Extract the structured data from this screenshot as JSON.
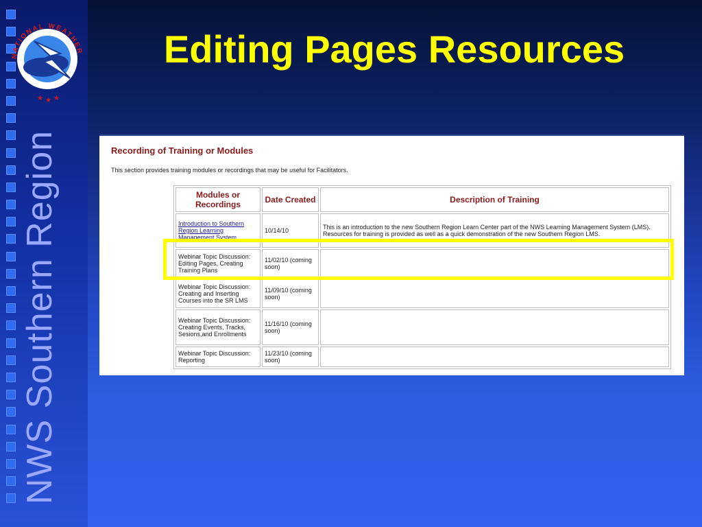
{
  "slide": {
    "title": "Editing Pages Resources",
    "sidebar_text": "NWS Southern Region",
    "logo": {
      "arc_text": "NATIONAL WEATHER SERVICE",
      "icon": "nws-logo-icon"
    }
  },
  "screenshot": {
    "heading": "Recording of Training or Modules",
    "intro": "This section provides training modules or recordings that may be useful for Facilitators.",
    "columns": [
      "Modules or Recordings",
      "Date Created",
      "Description of Training"
    ],
    "rows": [
      {
        "module": "Introduction to Southern Region Learning Management System",
        "date": "10/14/10",
        "description": "This is an introduction to the new Southern Region Learn Center part of the NWS Learning Management System (LMS). Resources for training is provided as well as a quick demonstration of the new Southern Region LMS."
      },
      {
        "module": "Webinar Topic Discussion: Editing Pages, Creating Training Plans",
        "date": "11/02/10 (coming soon)",
        "description": ""
      },
      {
        "module": "Webinar Topic Discussion: Creating and Inserting Courses into the SR LMS",
        "date": "11/09/10 (coming soon)",
        "description": ""
      },
      {
        "module": "Webinar Topic Discussion: Creating Events, Tracks, Sesions,and Enrollments",
        "date": "11/16/10 (coming soon)",
        "description": ""
      },
      {
        "module": "Webinar Topic Discussion: Reporting",
        "date": "11/23/10 (coming soon)",
        "description": ""
      }
    ]
  },
  "colors": {
    "title": "#ffff00",
    "highlight": "#ffff00",
    "heading": "#8b1a1a",
    "link": "#1a1a9a"
  }
}
